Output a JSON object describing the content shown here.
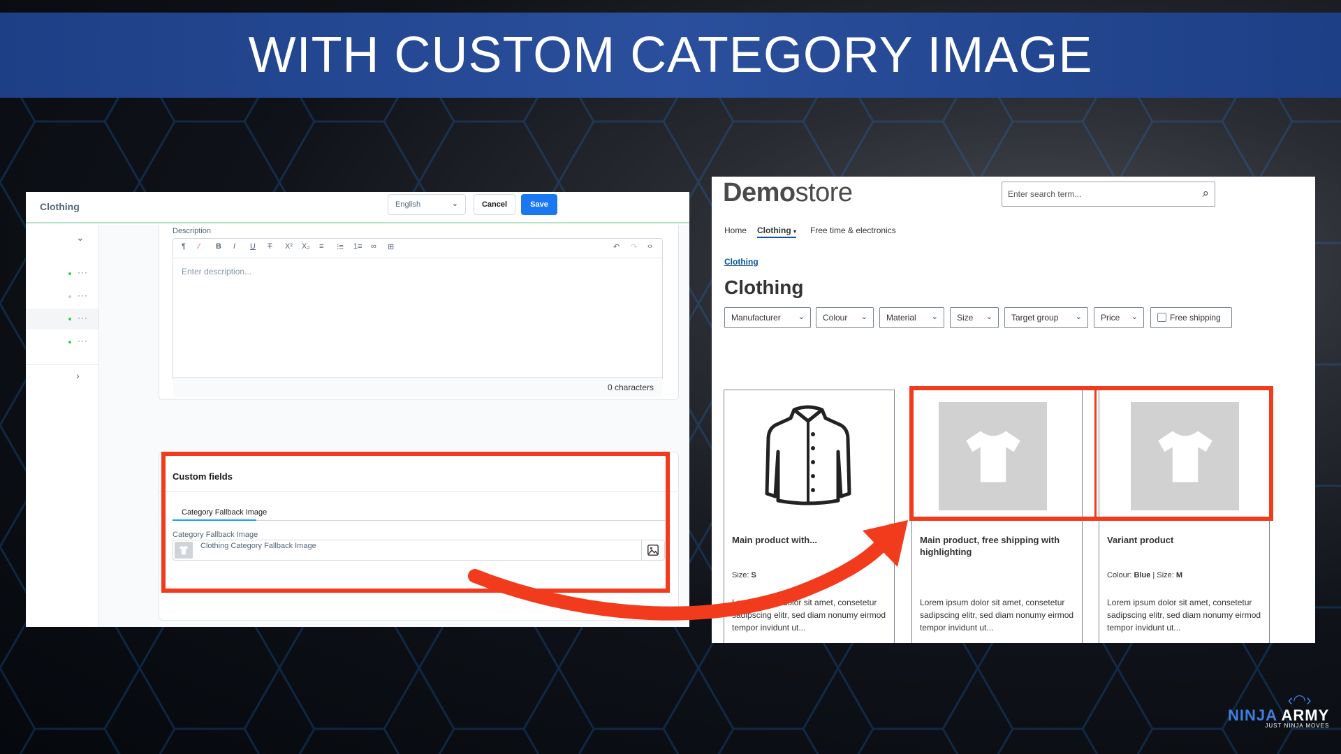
{
  "banner": {
    "title": "WITH CUSTOM CATEGORY IMAGE"
  },
  "admin": {
    "title": "Clothing",
    "language": "English",
    "cancel_label": "Cancel",
    "save_label": "Save",
    "description_label": "Description",
    "description_placeholder": "Enter description...",
    "char_count": "0 characters",
    "sidebar_rows": [
      {
        "status_color": "#37d046"
      },
      {
        "status_color": "#c5ced6"
      },
      {
        "status_color": "#37d046"
      },
      {
        "status_color": "#37d046"
      }
    ],
    "custom_fields": {
      "title": "Custom fields",
      "tab_label": "Category Fallback Image",
      "field_label": "Category Fallback Image",
      "field_value": "Clothing Category Fallback Image"
    }
  },
  "store": {
    "logo_bold": "Demo",
    "logo_light": "store",
    "search_placeholder": "Enter search term...",
    "nav": {
      "home": "Home",
      "clothing": "Clothing",
      "free_time": "Free time & electronics"
    },
    "breadcrumb": "Clothing",
    "page_title": "Clothing",
    "filters": {
      "manufacturer": "Manufacturer",
      "colour": "Colour",
      "material": "Material",
      "size": "Size",
      "target_group": "Target group",
      "price": "Price",
      "free_shipping": "Free shipping"
    },
    "products": [
      {
        "name": "Main product with...",
        "prop_label": "Size:",
        "prop_value": "S",
        "description": "Lorem ipsum dolor sit amet, consetetur sadipscing elitr, sed diam nonumy eirmod tempor invidunt ut..."
      },
      {
        "name": "Main product, free shipping with highlighting",
        "description": "Lorem ipsum dolor sit amet, consetetur sadipscing elitr, sed diam nonumy eirmod tempor invidunt ut..."
      },
      {
        "name": "Variant product",
        "prop_label": "Colour:",
        "prop_value": "Blue",
        "prop2_label": "Size:",
        "prop2_value": "M",
        "description": "Lorem ipsum dolor sit amet, consetetur sadipscing elitr, sed diam nonumy eirmod tempor invidunt ut..."
      }
    ]
  },
  "branding": {
    "ninja": "NINJA",
    "army": " ARMY",
    "tagline": "JUST NINJA MOVES"
  },
  "colors": {
    "highlight": "#f23a1d",
    "banner": "#2a4f9c",
    "accent": "#1a78f2"
  }
}
